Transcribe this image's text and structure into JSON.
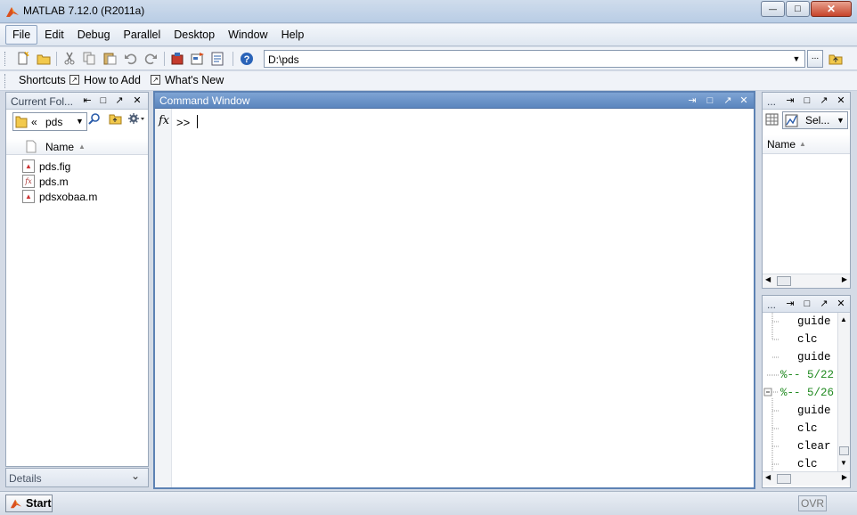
{
  "window": {
    "title": "MATLAB  7.12.0 (R2011a)",
    "controls": {
      "minimize": "—",
      "maximize": "□",
      "close": "✕"
    }
  },
  "menu": [
    "File",
    "Edit",
    "Debug",
    "Parallel",
    "Desktop",
    "Window",
    "Help"
  ],
  "toolbar": {
    "current_path": "D:\\pds",
    "browse_label": "...",
    "icons": [
      "new-file-icon",
      "open-folder-icon",
      "cut-icon",
      "copy-icon",
      "paste-icon",
      "undo-icon",
      "redo-icon",
      "simulink-icon",
      "guide-icon",
      "profiler-icon",
      "help-icon"
    ]
  },
  "shortcuts": {
    "label": "Shortcuts",
    "items": [
      "How to Add",
      "What's New"
    ]
  },
  "current_folder": {
    "title": "Current Fol...",
    "path_prefix": "«",
    "path": "pds",
    "column_name": "Name",
    "files": [
      {
        "name": "pds.fig",
        "icon": "fig-file-icon"
      },
      {
        "name": "pds.m",
        "icon": "function-file-icon"
      },
      {
        "name": "pdsxobaa.m",
        "icon": "m-file-icon"
      }
    ],
    "details_label": "Details"
  },
  "command_window": {
    "title": "Command Window",
    "fx": "fx",
    "prompt": ">>"
  },
  "workspace": {
    "title": "...",
    "select_label": "Sel...",
    "column_name": "Name"
  },
  "history": {
    "title": "...",
    "lines": [
      {
        "text": "guide",
        "type": "cmd"
      },
      {
        "text": "clc",
        "type": "cmd"
      },
      {
        "text": "guide",
        "type": "cmd"
      },
      {
        "text": "%-- 5/22",
        "type": "session"
      },
      {
        "text": "%-- 5/26",
        "type": "session"
      },
      {
        "text": "guide",
        "type": "cmd"
      },
      {
        "text": "clc",
        "type": "cmd"
      },
      {
        "text": "clear",
        "type": "cmd"
      },
      {
        "text": "clc",
        "type": "cmd"
      }
    ]
  },
  "statusbar": {
    "start_label": "Start",
    "ovr": "OVR"
  }
}
